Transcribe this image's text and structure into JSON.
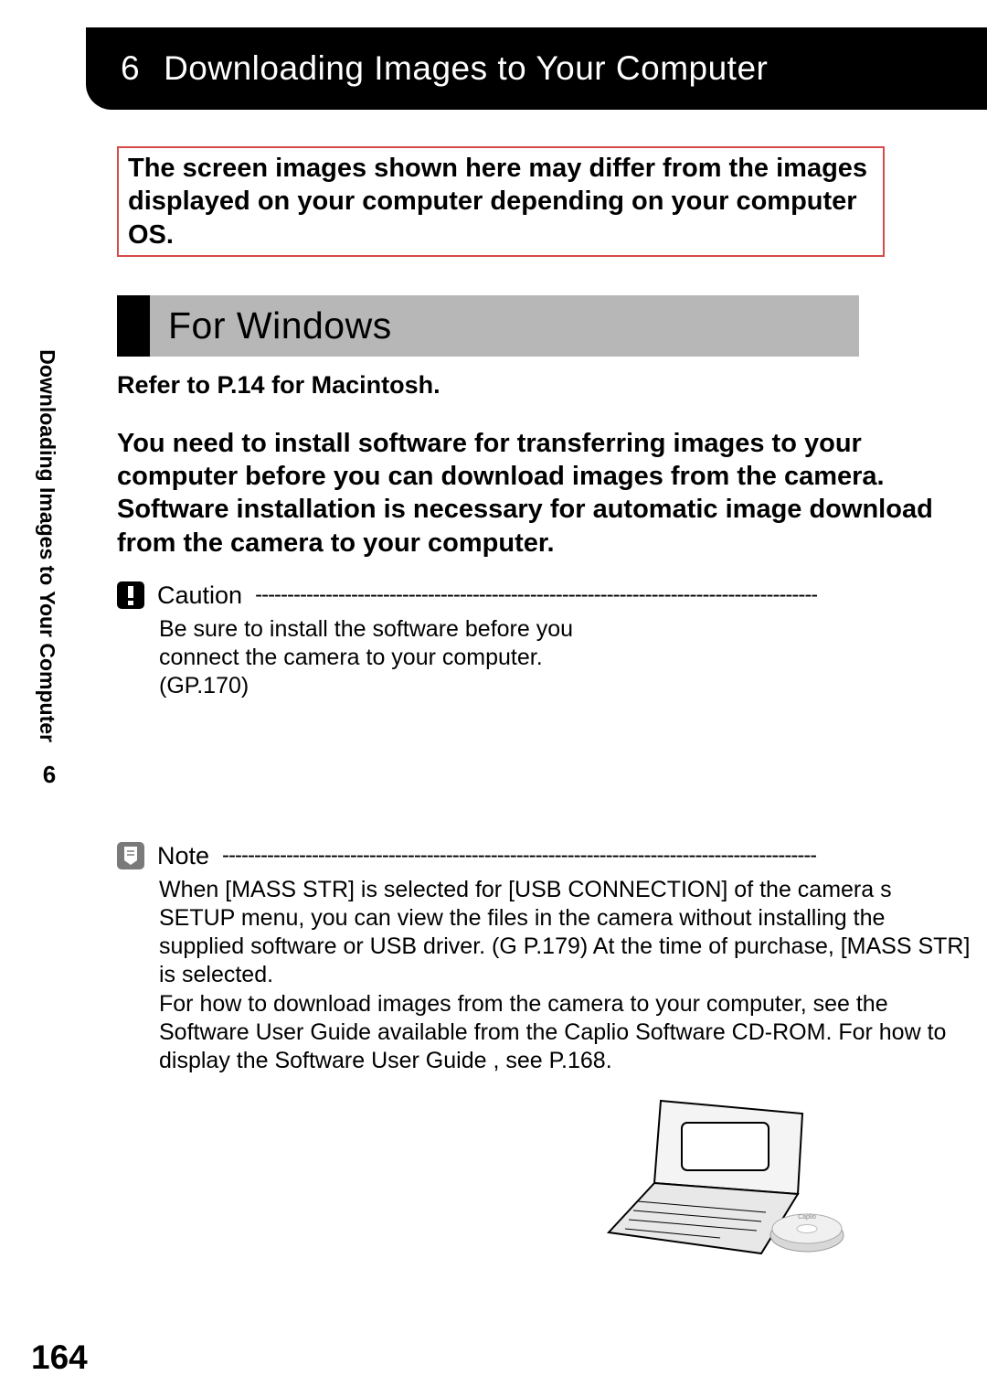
{
  "chapter": {
    "number": "6",
    "title": "Downloading Images to Your Computer"
  },
  "disclaimer": "The screen images shown here may differ from the images displayed on your computer depending on your computer OS.",
  "vertical_label": "Downloading Images to Your Computer",
  "vertical_section_number": "6",
  "section": {
    "title": "For Windows"
  },
  "sub_reference": "Refer to P.14 for Macintosh.",
  "body_intro": "You need to install software for transferring images to your computer before you can download images from the camera. Software installation is necessary for automatic image download from the camera to your computer.",
  "caution": {
    "label": "Caution",
    "dashes": "----------------------------------------------------------------------------------------",
    "text": "Be sure to install the software before you connect the camera to your computer. (GP.170)"
  },
  "note": {
    "label": "Note",
    "dashes": "---------------------------------------------------------------------------------------------",
    "text": "When [MASS STR] is selected for [USB CONNECTION] of the camera s SETUP menu, you can view the files in the camera without installing the supplied software or USB driver. (G   P.179) At the time of purchase, [MASS STR] is selected.\nFor how to download images from the camera to your computer, see the  Software User Guide  available from the Caplio Software CD-ROM. For how to display the  Software User Guide , see P.168."
  },
  "page_number": "164",
  "icons": {
    "caution": "caution-icon",
    "note": "note-icon"
  }
}
